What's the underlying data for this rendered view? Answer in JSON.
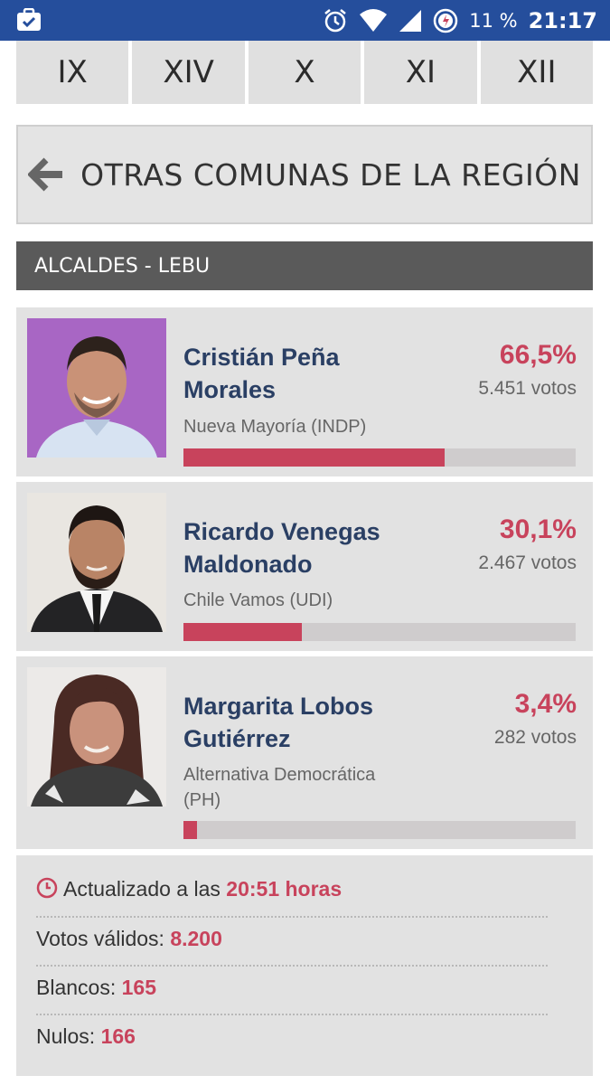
{
  "status_bar": {
    "battery_text": "11 %",
    "time": "21:17",
    "bg_color": "#254e9c"
  },
  "regions": [
    "IX",
    "XIV",
    "X",
    "XI",
    "XII"
  ],
  "otras_button": {
    "label": "OTRAS COMUNAS DE LA REGIÓN",
    "icon": "arrow-left-icon"
  },
  "section": {
    "title": "ALCALDES - LEBU"
  },
  "candidates": [
    {
      "name_line1": "Cristián Peña",
      "name_line2": "Morales",
      "party": "Nueva Mayoría (INDP)",
      "pct_label": "66,5%",
      "votes_label": "5.451 votos",
      "pct_value": 66.5
    },
    {
      "name_line1": "Ricardo Venegas",
      "name_line2": "Maldonado",
      "party": "Chile Vamos (UDI)",
      "pct_label": "30,1%",
      "votes_label": "2.467 votos",
      "pct_value": 30.1
    },
    {
      "name_line1": "Margarita Lobos",
      "name_line2": "Gutiérrez",
      "party_line1": "Alternativa Democrática",
      "party_line2": "(PH)",
      "pct_label": "3,4%",
      "votes_label": "282 votos",
      "pct_value": 3.4
    }
  ],
  "summary": {
    "updated_prefix": "Actualizado a las",
    "updated_time": "20:51 horas",
    "valid_label": "Votos válidos:",
    "valid_value": "8.200",
    "blank_label": "Blancos:",
    "blank_value": "165",
    "null_label": "Nulos:",
    "null_value": "166"
  },
  "colors": {
    "accent": "#c8435c",
    "name": "#2a3f64",
    "header": "#5a5a5a"
  }
}
